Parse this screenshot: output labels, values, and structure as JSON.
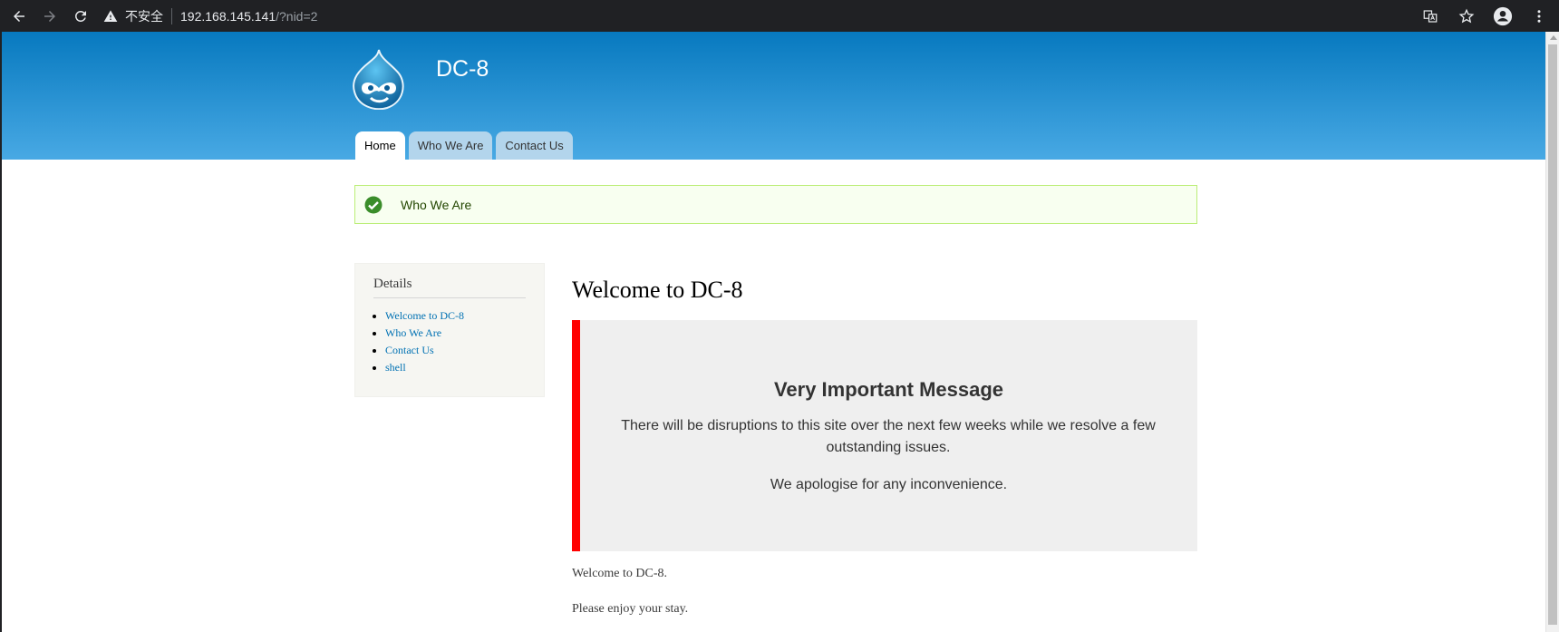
{
  "browser": {
    "security_label": "不安全",
    "url_host": "192.168.145.141",
    "url_path": "/?nid=2"
  },
  "site": {
    "name": "DC-8",
    "tabs": [
      {
        "label": "Home",
        "active": true
      },
      {
        "label": "Who We Are",
        "active": false
      },
      {
        "label": "Contact Us",
        "active": false
      }
    ]
  },
  "status_message": "Who We Are",
  "sidebar": {
    "title": "Details",
    "links": [
      "Welcome to DC-8",
      "Who We Are",
      "Contact Us",
      "shell"
    ]
  },
  "main": {
    "title": "Welcome to DC-8",
    "notice": {
      "heading": "Very Important Message",
      "paragraph1": "There will be disruptions to this site over the next few weeks while we resolve a few outstanding issues.",
      "paragraph2": "We apologise for any inconvenience."
    },
    "body1": "Welcome to DC-8.",
    "body2": "Please enjoy your stay."
  },
  "colors": {
    "header_top": "#0779bf",
    "header_bottom": "#48a9e4",
    "notice_accent": "#ff0000",
    "link": "#0071b3"
  }
}
